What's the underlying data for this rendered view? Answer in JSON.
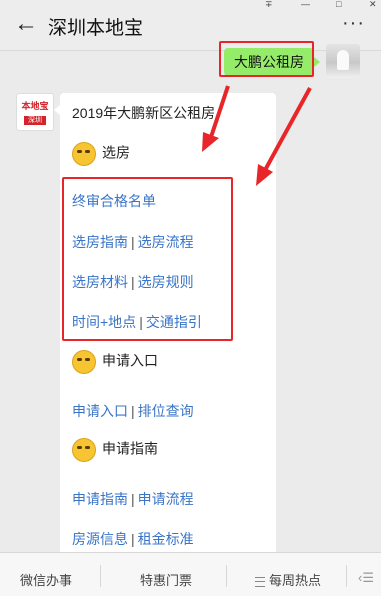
{
  "header": {
    "back_glyph": "←",
    "title": "深圳本地宝",
    "more_glyph": "···",
    "sys_icons": [
      "∓",
      "—",
      "□",
      "✕"
    ]
  },
  "outgoing": {
    "message": "大鹏公租房"
  },
  "incoming": {
    "avatar_line1": "本地宝",
    "avatar_line2": "深圳",
    "heading": "2019年大鹏新区公租房",
    "sections": [
      {
        "title": "选房"
      },
      {
        "title": "申请入口"
      },
      {
        "title": "申请指南"
      }
    ],
    "links": {
      "final_list": "终审合格名单",
      "select_guide": "选房指南",
      "select_flow": "选房流程",
      "select_materials": "选房材料",
      "select_rules": "选房规则",
      "time_place": "时间+地点",
      "traffic": "交通指引",
      "apply_entry": "申请入口",
      "queue_query": "排位查询",
      "apply_guide": "申请指南",
      "apply_flow": "申请流程",
      "housing_info": "房源信息",
      "rent_standard": "租金标准"
    },
    "separator": "|"
  },
  "bottom_menu": {
    "items": [
      "微信办事",
      "特惠门票",
      "每周热点"
    ],
    "edge_glyph": "‹☰"
  },
  "colors": {
    "bubble_green": "#95ec69",
    "link_blue": "#3a74c7",
    "annotation_red": "#e8262a"
  }
}
